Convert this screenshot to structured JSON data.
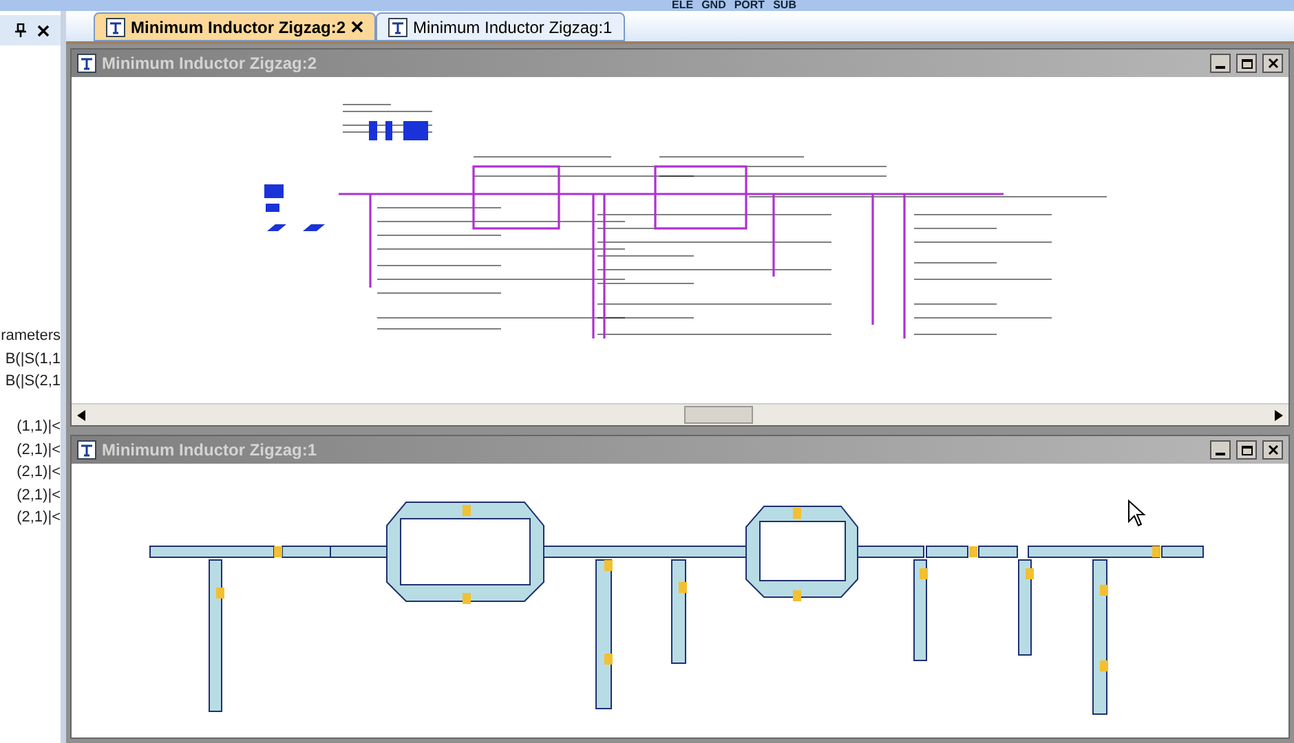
{
  "toolbar": {
    "buttons": [
      "ELE",
      "GND",
      "PORT",
      "SUB"
    ]
  },
  "side_panel": {
    "groups": [
      [
        "rameters",
        "B(|S(1,1",
        "B(|S(2,1"
      ],
      [
        "(1,1)|<",
        "(2,1)|<",
        "(2,1)|<",
        "(2,1)|<",
        "(2,1)|<"
      ]
    ]
  },
  "tabs": [
    {
      "label": "Minimum Inductor Zigzag:2",
      "selected": true
    },
    {
      "label": "Minimum Inductor Zigzag:1",
      "selected": false
    }
  ],
  "windows": [
    {
      "title": "Minimum Inductor Zigzag:2",
      "kind": "schematic"
    },
    {
      "title": "Minimum Inductor Zigzag:1",
      "kind": "layout"
    }
  ]
}
